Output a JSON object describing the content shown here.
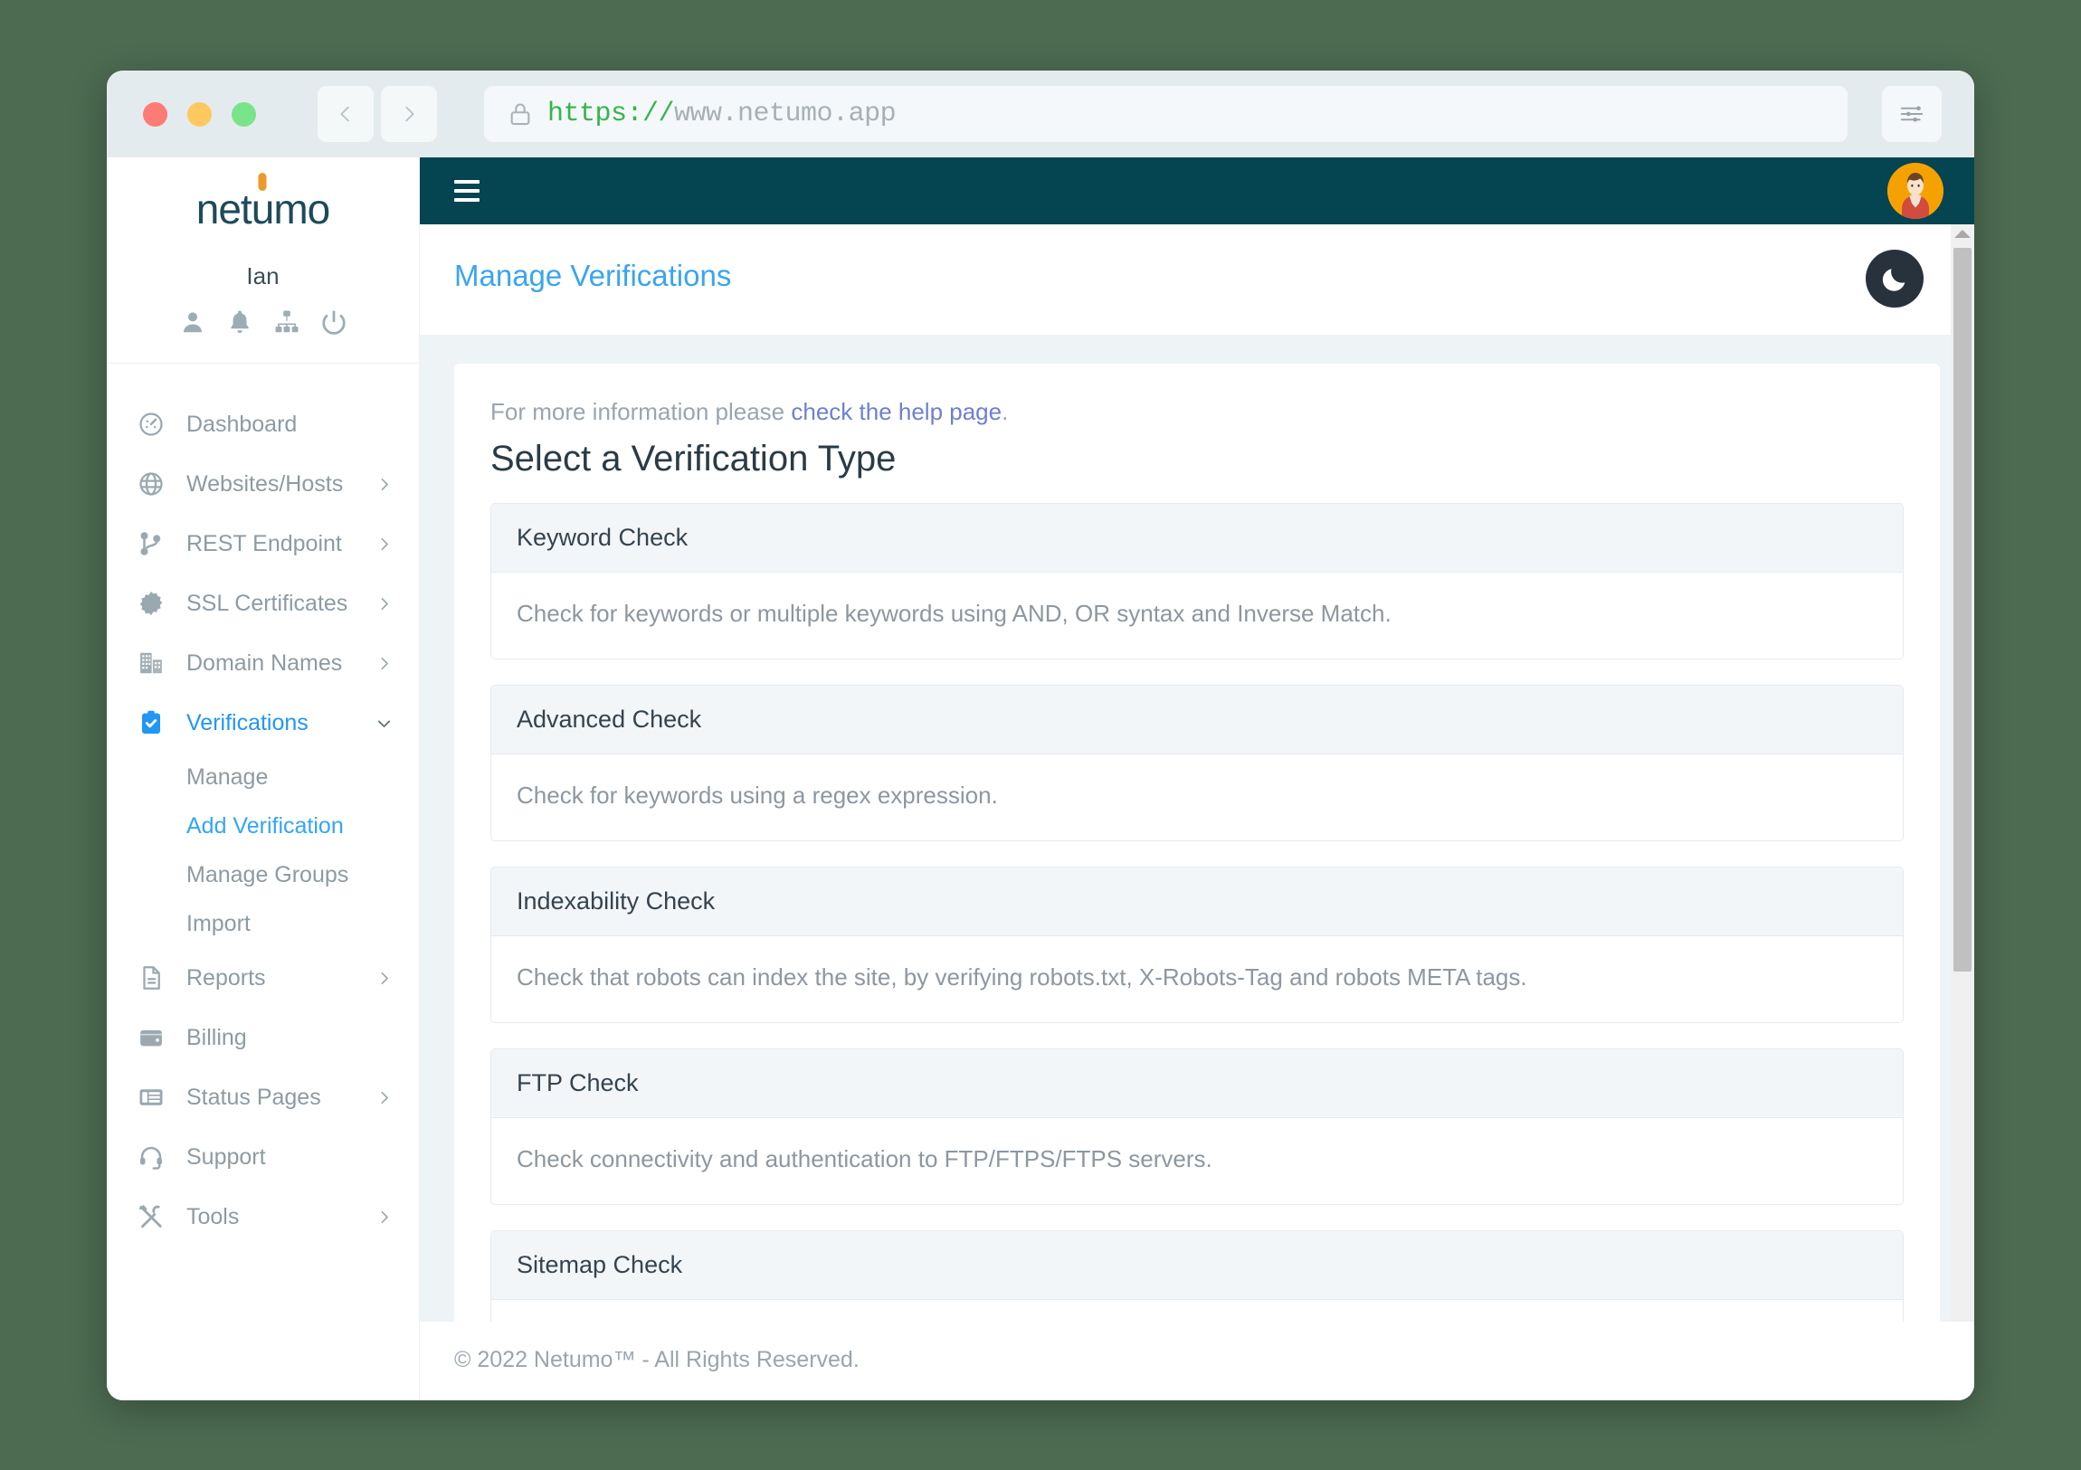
{
  "browser": {
    "url_scheme": "https://",
    "url_host": "www.netumo.app",
    "lock_icon": "lock-icon",
    "back_icon": "chevron-left-icon",
    "forward_icon": "chevron-right-icon",
    "settings_icon": "sliders-icon",
    "traffic_lights": [
      "close-red",
      "minimize-yellow",
      "maximize-green"
    ]
  },
  "sidebar": {
    "logo": {
      "part1": "net",
      "part2": "u",
      "part3": "mo"
    },
    "user": {
      "name": "Ian",
      "icons": [
        {
          "name": "profile-icon"
        },
        {
          "name": "bell-icon"
        },
        {
          "name": "sitemap-icon"
        },
        {
          "name": "power-icon"
        }
      ]
    },
    "items": [
      {
        "label": "Dashboard",
        "icon": "dashboard-icon",
        "chevron": "",
        "active": false
      },
      {
        "label": "Websites/Hosts",
        "icon": "globe-icon",
        "chevron": "right",
        "active": false
      },
      {
        "label": "REST Endpoint",
        "icon": "branch-icon",
        "chevron": "right",
        "active": false
      },
      {
        "label": "SSL Certificates",
        "icon": "certificate-icon",
        "chevron": "right",
        "active": false
      },
      {
        "label": "Domain Names",
        "icon": "building-icon",
        "chevron": "right",
        "active": false
      },
      {
        "label": "Verifications",
        "icon": "clipboard-check-icon",
        "chevron": "down",
        "active": true
      }
    ],
    "sub_items": [
      {
        "label": "Manage",
        "active": false
      },
      {
        "label": "Add Verification",
        "active": true
      },
      {
        "label": "Manage Groups",
        "active": false
      },
      {
        "label": "Import",
        "active": false
      }
    ],
    "items_after": [
      {
        "label": "Reports",
        "icon": "document-icon",
        "chevron": "right",
        "active": false
      },
      {
        "label": "Billing",
        "icon": "wallet-icon",
        "chevron": "",
        "active": false
      },
      {
        "label": "Status Pages",
        "icon": "status-page-icon",
        "chevron": "right",
        "active": false
      },
      {
        "label": "Support",
        "icon": "headset-icon",
        "chevron": "",
        "active": false
      },
      {
        "label": "Tools",
        "icon": "tools-icon",
        "chevron": "right",
        "active": false
      }
    ]
  },
  "topbar": {
    "menu_icon": "hamburger-icon",
    "avatar": "user-avatar"
  },
  "page": {
    "breadcrumb": "Manage Verifications",
    "darkmode_icon": "moon-icon",
    "help_prefix": "For more information please ",
    "help_link": "check the help page",
    "help_suffix": ".",
    "section_title": "Select a Verification Type"
  },
  "verification_types": [
    {
      "title": "Keyword Check",
      "description": "Check for keywords or multiple keywords using AND, OR syntax and Inverse Match."
    },
    {
      "title": "Advanced Check",
      "description": "Check for keywords using a regex expression."
    },
    {
      "title": "Indexability Check",
      "description": "Check that robots can index the site, by verifying robots.txt, X-Robots-Tag and robots META tags."
    },
    {
      "title": "FTP Check",
      "description": "Check connectivity and authentication to FTP/FTPS/FTPS servers."
    },
    {
      "title": "Sitemap Check",
      "description": ""
    }
  ],
  "footer": {
    "copyright": "© 2022 Netumo™ - All Rights Reserved."
  },
  "colors": {
    "navbar": "#054451",
    "accent_blue": "#2196f3",
    "link_blue": "#3aa5f0",
    "logo_teal": "#1d4a5a",
    "logo_orange": "#f0992b",
    "avatar_orange": "#f5a201",
    "url_green": "#35b54a",
    "help_link_purple": "#6f7fd0",
    "page_background": "#eef3f6",
    "desktop_background": "#4c6b51"
  }
}
